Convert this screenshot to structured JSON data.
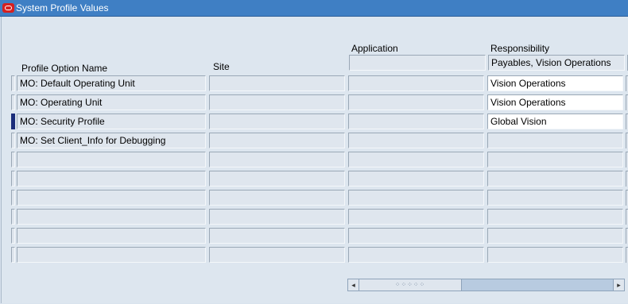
{
  "window": {
    "title": "System Profile Values"
  },
  "headers": {
    "profile_option_name": "Profile Option Name",
    "site": "Site",
    "application": "Application",
    "responsibility": "Responsibility"
  },
  "header_values": {
    "responsibility": "Payables, Vision Operations"
  },
  "rows": [
    {
      "name": "MO: Default Operating Unit",
      "site": "",
      "application": "",
      "responsibility": "Vision Operations"
    },
    {
      "name": "MO: Operating Unit",
      "site": "",
      "application": "",
      "responsibility": "Vision Operations"
    },
    {
      "name": "MO: Security Profile",
      "site": "",
      "application": "",
      "responsibility": "Global Vision"
    },
    {
      "name": "MO: Set Client_Info for Debugging",
      "site": "",
      "application": "",
      "responsibility": ""
    },
    {
      "name": "",
      "site": "",
      "application": "",
      "responsibility": ""
    },
    {
      "name": "",
      "site": "",
      "application": "",
      "responsibility": ""
    },
    {
      "name": "",
      "site": "",
      "application": "",
      "responsibility": ""
    },
    {
      "name": "",
      "site": "",
      "application": "",
      "responsibility": ""
    },
    {
      "name": "",
      "site": "",
      "application": "",
      "responsibility": ""
    },
    {
      "name": "",
      "site": "",
      "application": "",
      "responsibility": ""
    }
  ],
  "scrollbar": {
    "left_arrow": "◂",
    "right_arrow": "▸",
    "grip": "⁘⁘⁘⁘⁘"
  }
}
